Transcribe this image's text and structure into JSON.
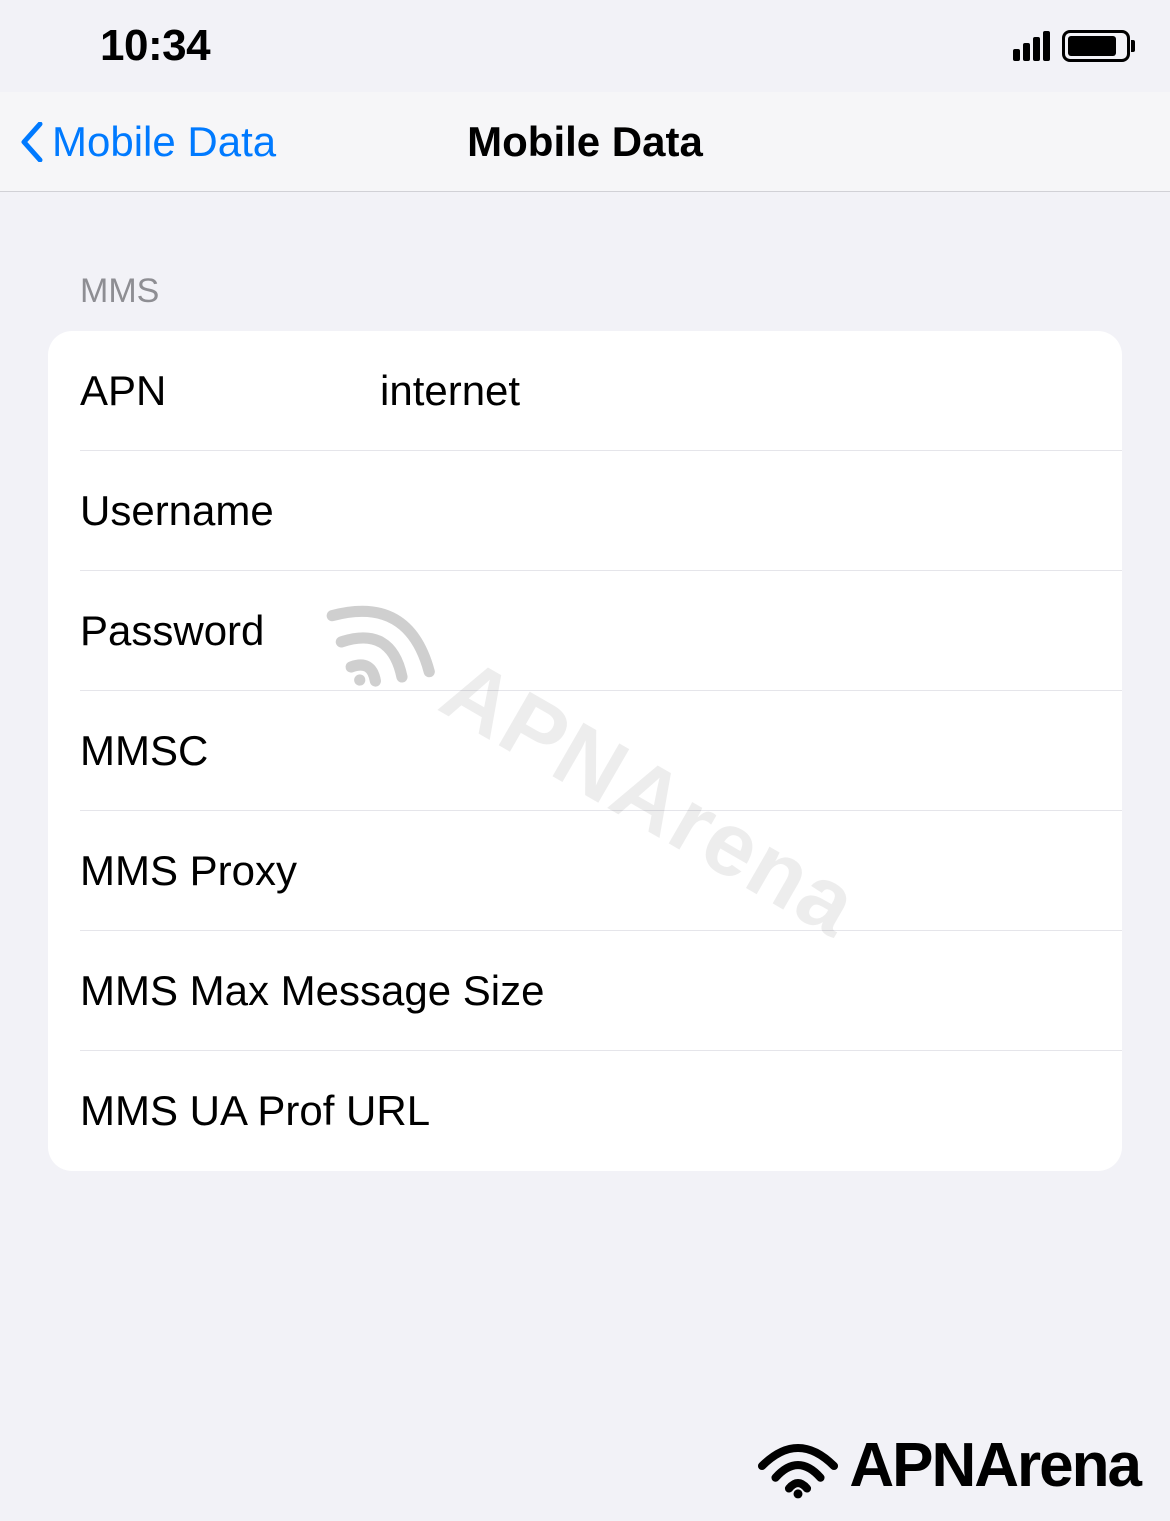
{
  "status": {
    "time": "10:34"
  },
  "nav": {
    "back_label": "Mobile Data",
    "title": "Mobile Data"
  },
  "section": {
    "header": "MMS",
    "rows": {
      "apn": {
        "label": "APN",
        "value": "internet"
      },
      "username": {
        "label": "Username",
        "value": ""
      },
      "password": {
        "label": "Password",
        "value": ""
      },
      "mmsc": {
        "label": "MMSC",
        "value": ""
      },
      "mms_proxy": {
        "label": "MMS Proxy",
        "value": ""
      },
      "mms_max_size": {
        "label": "MMS Max Message Size",
        "value": ""
      },
      "mms_ua_prof": {
        "label": "MMS UA Prof URL",
        "value": ""
      }
    }
  },
  "watermark": {
    "text": "APNArena"
  },
  "footer": {
    "brand": "APNArena"
  }
}
